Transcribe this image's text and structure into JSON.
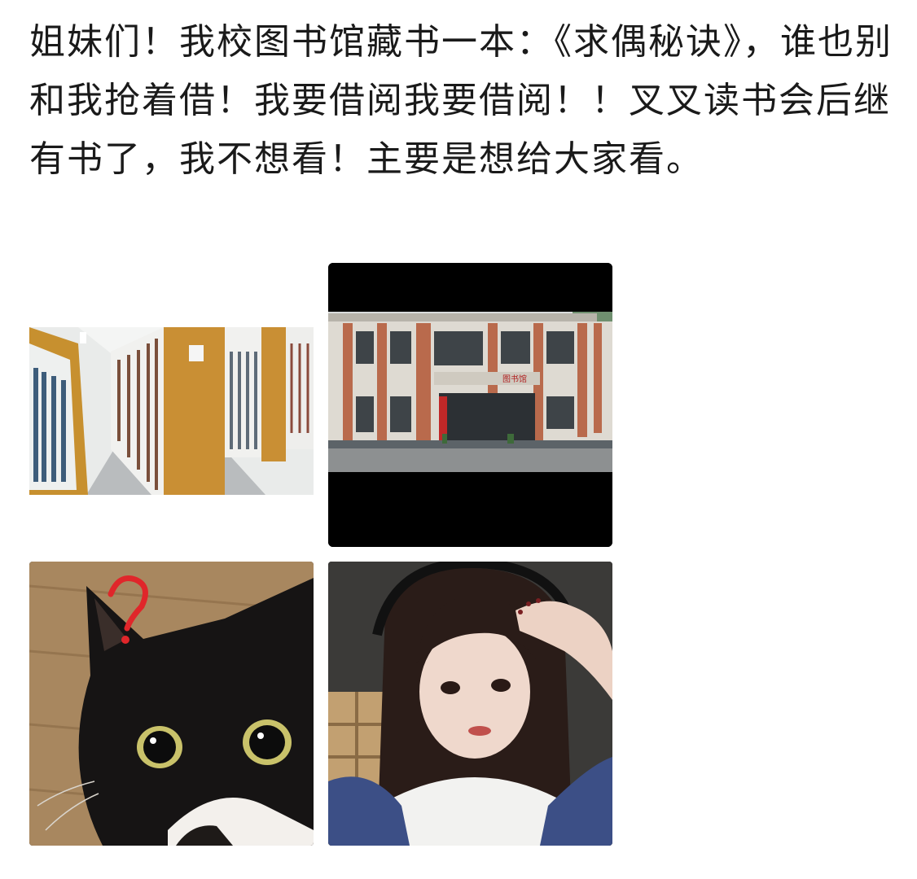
{
  "post": {
    "text": "姐妹们！我校图书馆藏书一本：《求偶秘诀》，谁也别和我抢着借！我要借阅我要借阅！！叉叉读书会后继有书了，我不想看！主要是想给大家看。"
  },
  "building_sign": "图书馆",
  "images": [
    {
      "icon": "library-aisle-photo"
    },
    {
      "icon": "library-building-photo"
    },
    {
      "icon": "black-cat-question-photo"
    },
    {
      "icon": "girl-selfie-photo"
    }
  ]
}
